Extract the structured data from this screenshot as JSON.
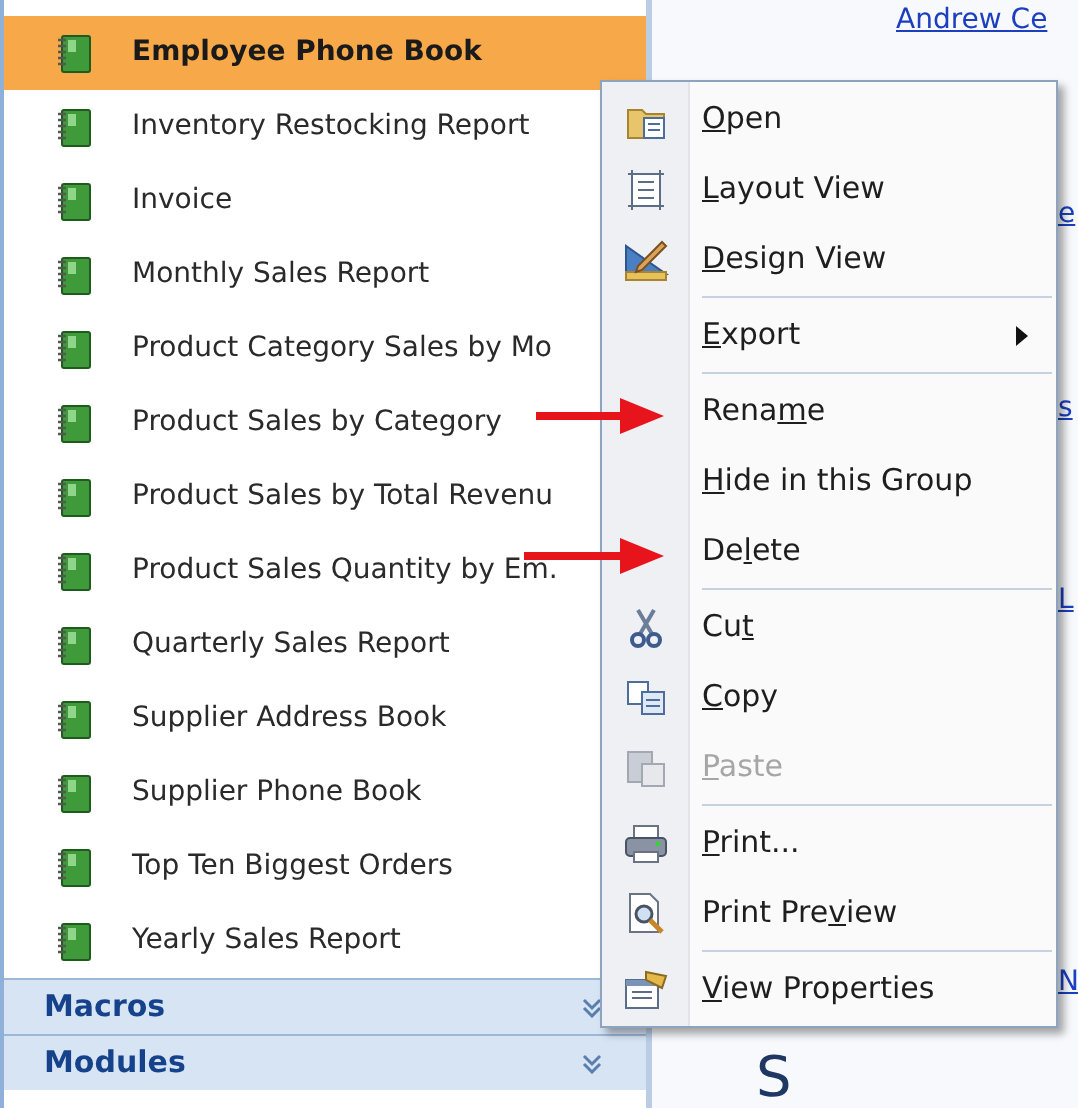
{
  "navigation_pane": {
    "reports": [
      {
        "label": "Employee Phone Book",
        "selected": true
      },
      {
        "label": "Inventory Restocking Report",
        "selected": false
      },
      {
        "label": "Invoice",
        "selected": false
      },
      {
        "label": "Monthly Sales Report",
        "selected": false
      },
      {
        "label": "Product Category Sales by Mo",
        "selected": false
      },
      {
        "label": "Product Sales by Category",
        "selected": false
      },
      {
        "label": "Product Sales by Total Revenu",
        "selected": false
      },
      {
        "label": "Product Sales Quantity by Em.",
        "selected": false
      },
      {
        "label": "Quarterly Sales Report",
        "selected": false
      },
      {
        "label": "Supplier Address Book",
        "selected": false
      },
      {
        "label": "Supplier Phone Book",
        "selected": false
      },
      {
        "label": "Top Ten Biggest Orders",
        "selected": false
      },
      {
        "label": "Yearly Sales Report",
        "selected": false
      }
    ],
    "groups": [
      {
        "label": "Macros",
        "expanded": false
      },
      {
        "label": "Modules",
        "expanded": false
      }
    ]
  },
  "background": {
    "links": [
      {
        "text": "Andrew Ce"
      },
      {
        "text": "e"
      },
      {
        "text": "s"
      },
      {
        "text": "L"
      },
      {
        "text": "N"
      }
    ],
    "heading": "S"
  },
  "context_menu": [
    {
      "kind": "item",
      "key": "O",
      "after": "pen",
      "disabled": false
    },
    {
      "kind": "item",
      "key": "L",
      "after": "ayout View",
      "disabled": false
    },
    {
      "kind": "item",
      "key": "D",
      "after": "esign View",
      "disabled": false
    },
    {
      "kind": "separator"
    },
    {
      "kind": "item",
      "key": "E",
      "after": "xport",
      "disabled": false,
      "submenu": true
    },
    {
      "kind": "separator"
    },
    {
      "kind": "item",
      "before": "Rena",
      "key": "m",
      "after": "e",
      "disabled": false
    },
    {
      "kind": "item",
      "key": "H",
      "after": "ide in this Group",
      "disabled": false
    },
    {
      "kind": "item",
      "before": "De",
      "key": "l",
      "after": "ete",
      "disabled": false
    },
    {
      "kind": "separator"
    },
    {
      "kind": "item",
      "before": "Cu",
      "key": "t",
      "disabled": false
    },
    {
      "kind": "item",
      "key": "C",
      "after": "opy",
      "disabled": false
    },
    {
      "kind": "item",
      "key": "P",
      "after": "aste",
      "disabled": true
    },
    {
      "kind": "separator"
    },
    {
      "kind": "item",
      "key": "P",
      "after": "rint...",
      "disabled": false
    },
    {
      "kind": "item",
      "before": "Print Pre",
      "key": "v",
      "after": "iew",
      "disabled": false
    },
    {
      "kind": "separator"
    },
    {
      "kind": "item",
      "key": "V",
      "after": "iew Properties",
      "disabled": false
    }
  ]
}
